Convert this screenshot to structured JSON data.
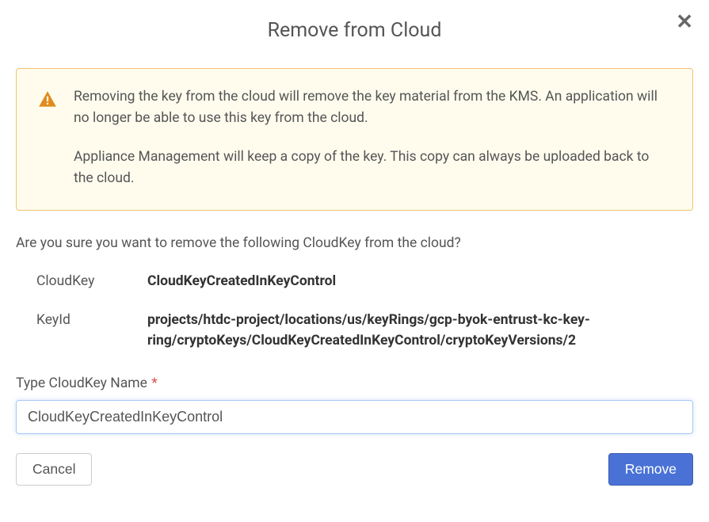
{
  "dialog": {
    "title": "Remove from Cloud"
  },
  "warning": {
    "paragraph1": "Removing the key from the cloud will remove the key material from the KMS. An application will no longer be able to use this key from the cloud.",
    "paragraph2": "Appliance Management will keep a copy of the key. This copy can always be uploaded back to the cloud."
  },
  "confirm_question": "Are you sure you want to remove the following CloudKey from the cloud?",
  "details": {
    "cloudkey_label": "CloudKey",
    "cloudkey_value": "CloudKeyCreatedInKeyControl",
    "keyid_label": "KeyId",
    "keyid_value": "projects/htdc-project/locations/us/keyRings/gcp-byok-entrust-kc-key-ring/cryptoKeys/CloudKeyCreatedInKeyControl/cryptoKeyVersions/2"
  },
  "input": {
    "label": "Type CloudKey Name",
    "value": "CloudKeyCreatedInKeyControl"
  },
  "buttons": {
    "cancel": "Cancel",
    "remove": "Remove"
  }
}
